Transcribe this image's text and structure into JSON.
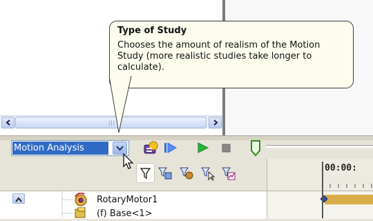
{
  "tooltip": {
    "title": "Type of Study",
    "body": "Chooses the amount of realism of the Motion Study (more realistic studies take longer to calculate)."
  },
  "study_type": {
    "selected": "Motion Analysis"
  },
  "timeline": {
    "time_label": "00:00:"
  },
  "tree": {
    "items": [
      {
        "label": "RotaryMotor1",
        "icon": "rotary-motor-icon"
      },
      {
        "label": "(f) Base<1>",
        "icon": "part-icon"
      }
    ]
  },
  "icons": {
    "toolbar": [
      "calculate-icon",
      "play-from-start-icon",
      "play-icon",
      "stop-icon"
    ],
    "filters": [
      "filter-icon",
      "filter-animated-icon",
      "filter-driving-icon",
      "filter-selected-icon",
      "filter-results-icon"
    ],
    "scrollbar_grip": "|||"
  },
  "colors": {
    "selection": "#316ac5",
    "tooltip_bg": "#fdfdee",
    "motor_bar": "#d8ad47",
    "play_green": "#27b53a",
    "play_blue": "#2f6de0"
  }
}
